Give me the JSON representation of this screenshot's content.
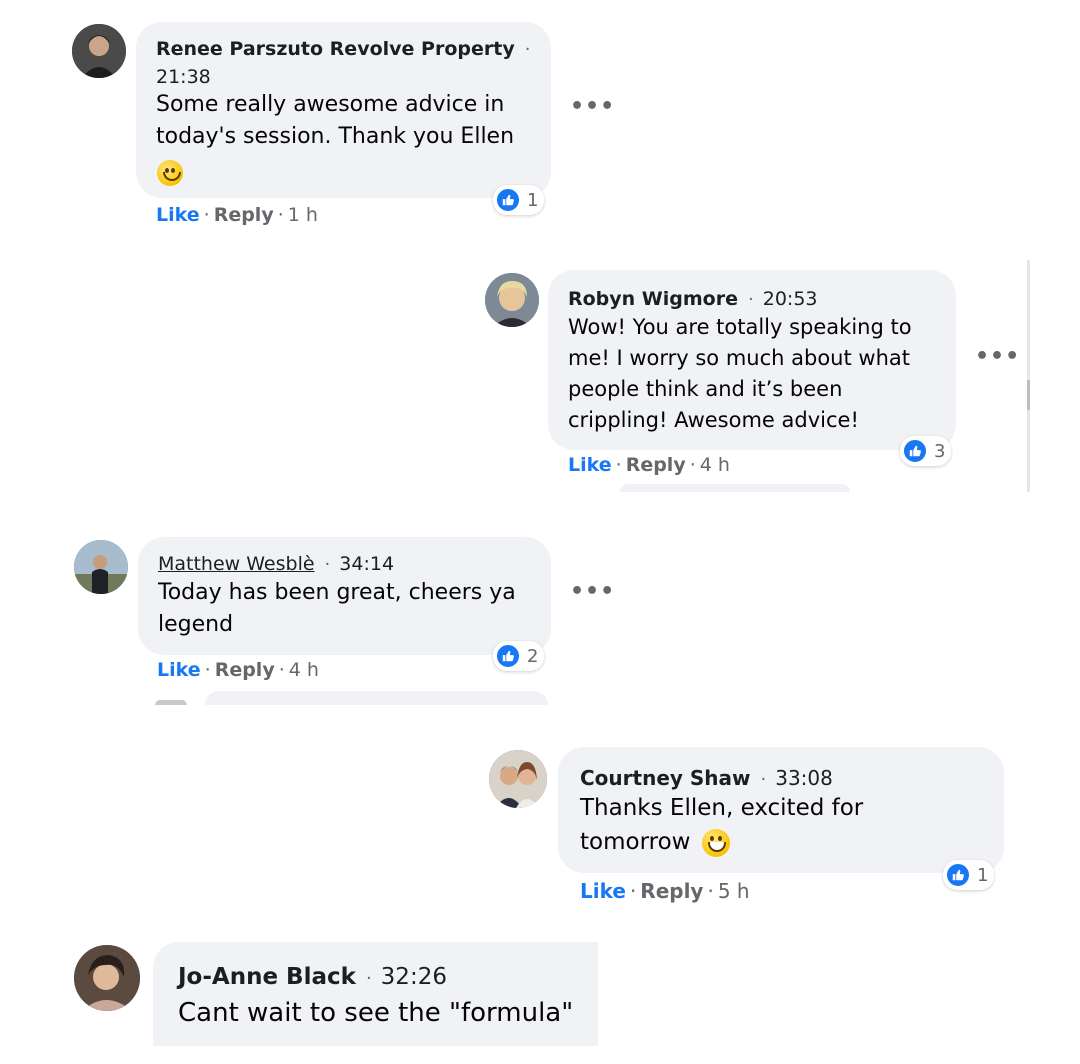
{
  "comments": [
    {
      "author": "Renee Parszuto Revolve Property",
      "time": "21:38",
      "text": "Some really awesome advice in today's session. Thank you Ellen",
      "emoji": "slightly-smiling-face",
      "reaction_count": "1",
      "like_label": "Like",
      "reply_label": "Reply",
      "ago": "1 h"
    },
    {
      "author": "Robyn Wigmore",
      "time": "20:53",
      "text": "Wow! You are totally speaking to me! I worry so much about what people think and it’s been crippling! Awesome advice!",
      "reaction_count": "3",
      "like_label": "Like",
      "reply_label": "Reply",
      "ago": "4 h"
    },
    {
      "author": "Matthew Wesblè",
      "time": "34:14",
      "text": "Today has been great, cheers ya legend",
      "reaction_count": "2",
      "like_label": "Like",
      "reply_label": "Reply",
      "ago": "4 h"
    },
    {
      "author": "Courtney Shaw",
      "time": "33:08",
      "text": "Thanks Ellen, excited for tomorrow",
      "emoji": "grinning-face",
      "reaction_count": "1",
      "like_label": "Like",
      "reply_label": "Reply",
      "ago": "5 h"
    },
    {
      "author": "Jo-Anne Black",
      "time": "32:26",
      "text": "Cant wait to see the \"formula\""
    }
  ],
  "separator": "·",
  "more_icon": "more-horizontal-icon",
  "colors": {
    "bubble": "#f0f2f5",
    "like_blue": "#1877f2",
    "meta_gray": "#65676b"
  }
}
